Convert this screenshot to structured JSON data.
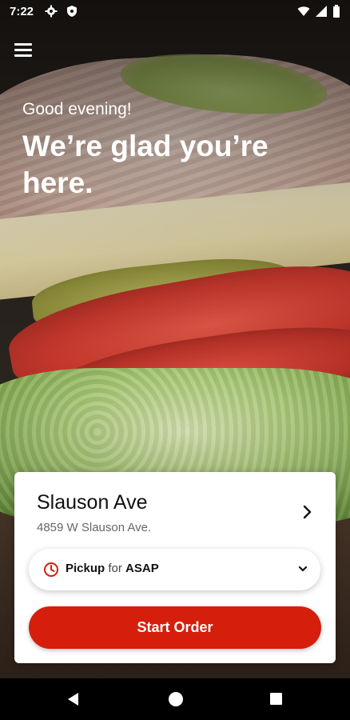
{
  "status_bar": {
    "time": "7:22",
    "left_icons": [
      "gear-icon",
      "shield-icon"
    ],
    "right_icons": [
      "wifi-icon",
      "signal-icon",
      "battery-icon"
    ]
  },
  "header": {
    "menu_icon": "hamburger-menu-icon"
  },
  "greeting": {
    "subtitle": "Good evening!",
    "title": "We’re glad you’re here."
  },
  "location_card": {
    "store_name": "Slauson Ave",
    "store_address": "4859 W Slauson Ave.",
    "pickup": {
      "mode_label": "Pickup",
      "connector": "for",
      "time_label": "ASAP"
    },
    "start_order_label": "Start Order",
    "accent_color": "#d51e0c"
  },
  "nav_bar": {
    "buttons": [
      "back",
      "home",
      "recents"
    ]
  }
}
